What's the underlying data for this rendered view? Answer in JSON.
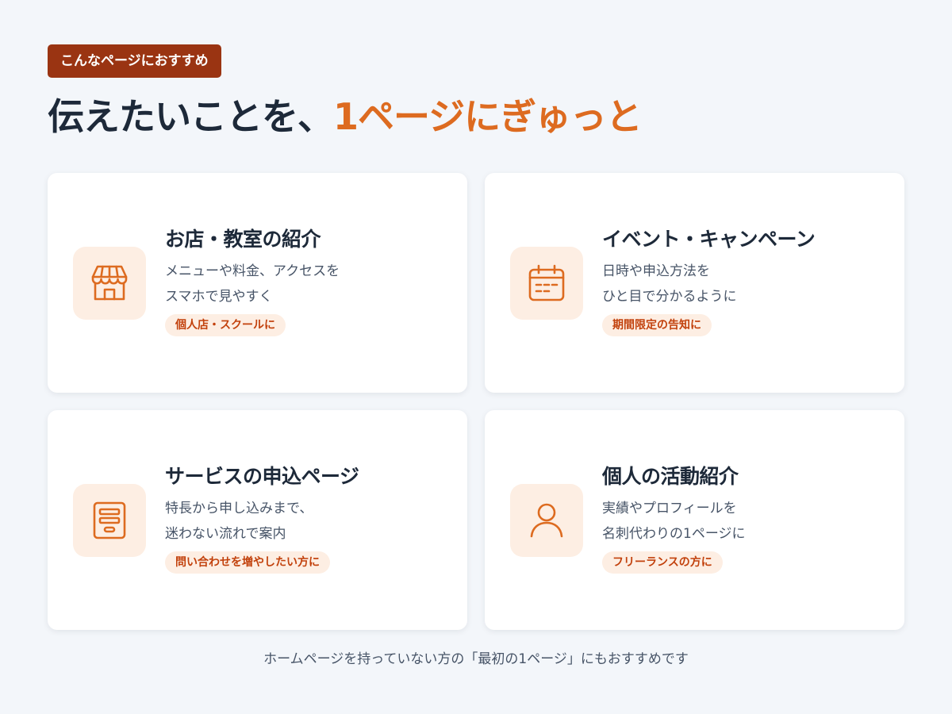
{
  "badge": "こんなページにおすすめ",
  "headline": {
    "main": "伝えたいことを、",
    "accent": "1ページにぎゅっと"
  },
  "cards": [
    {
      "icon": "shop-icon",
      "title": "お店・教室の紹介",
      "desc_line1": "メニューや料金、アクセスを",
      "desc_line2": "スマホで見やすく",
      "tag": "個人店・スクールに"
    },
    {
      "icon": "calendar-icon",
      "title": "イベント・キャンペーン",
      "desc_line1": "日時や申込方法を",
      "desc_line2": "ひと目で分かるように",
      "tag": "期間限定の告知に"
    },
    {
      "icon": "form-icon",
      "title": "サービスの申込ページ",
      "desc_line1": "特長から申し込みまで、",
      "desc_line2": "迷わない流れで案内",
      "tag": "問い合わせを増やしたい方に"
    },
    {
      "icon": "person-icon",
      "title": "個人の活動紹介",
      "desc_line1": "実績やプロフィールを",
      "desc_line2": "名刺代わりの1ページに",
      "tag": "フリーランスの方に"
    }
  ],
  "footer": "ホームページを持っていない方の「最初の1ページ」にもおすすめです",
  "colors": {
    "background": "#f3f6fa",
    "badge": "#9a3412",
    "accent": "#dd6b20",
    "icon_bg": "#fdeee3",
    "text_dark": "#1d2939",
    "text_muted": "#475467"
  }
}
